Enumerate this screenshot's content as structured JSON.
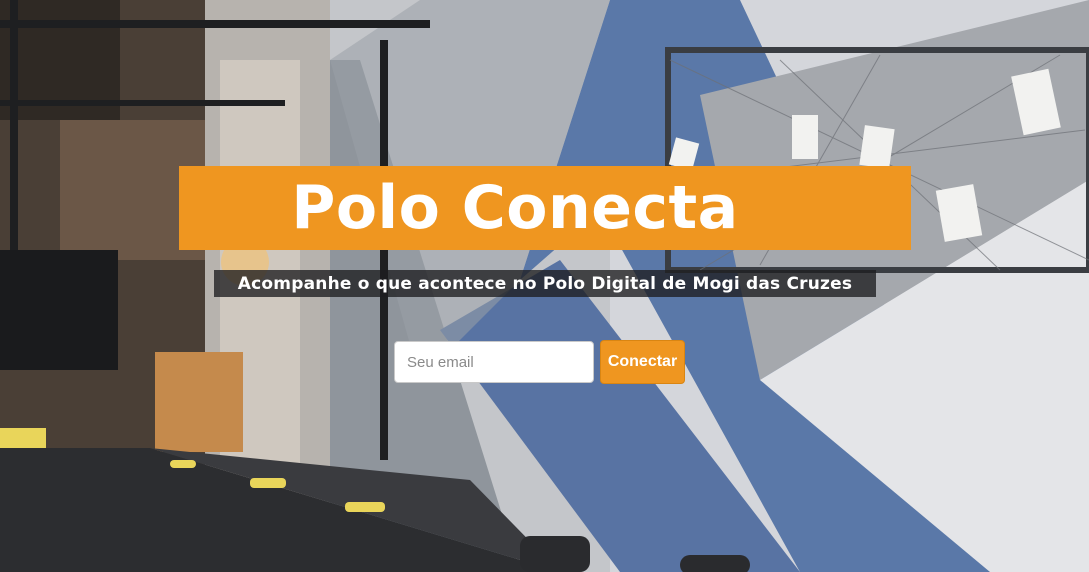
{
  "hero": {
    "title": "Polo Conecta",
    "subtitle": "Acompanhe o que acontece no Polo Digital de Mogi das Cruzes"
  },
  "signup": {
    "email_placeholder": "Seu email",
    "email_value": "",
    "button_label": "Conectar"
  },
  "colors": {
    "accent": "#ef9620",
    "subtitle_bg": "#1e1e20",
    "wall_blue": "#5a78a8",
    "wall_gray": "#a5a8ad"
  }
}
